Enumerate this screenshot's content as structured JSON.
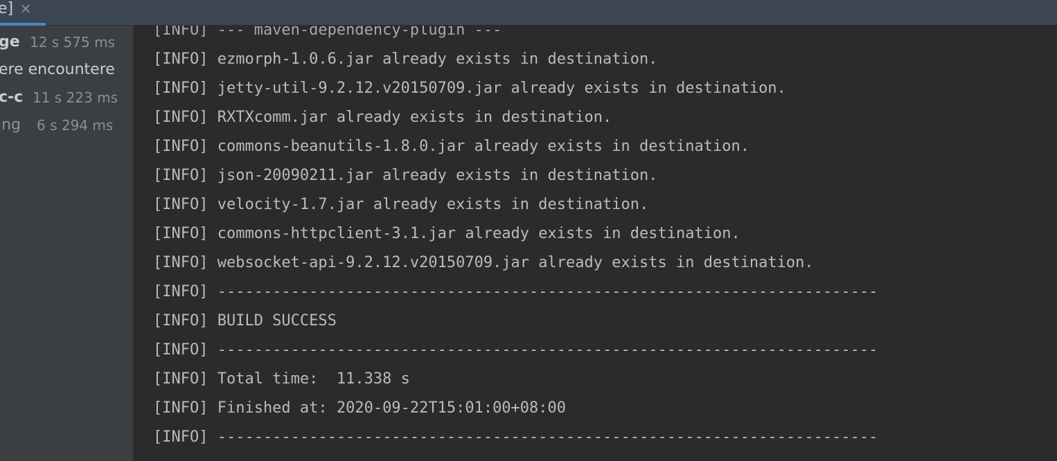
{
  "tab": {
    "label": "e]",
    "close_glyph": "×"
  },
  "sidebar": {
    "items": [
      {
        "name": "ge",
        "time": "12 s 575 ms"
      },
      {
        "name": "ere encountere",
        "time": ""
      },
      {
        "name": "c-c",
        "time": "11 s 223 ms"
      },
      {
        "name": "ing",
        "time": "6 s 294 ms"
      }
    ]
  },
  "console": {
    "partial_line": "[INFO] --- maven-dependency-plugin ---",
    "lines": [
      "[INFO] ezmorph-1.0.6.jar already exists in destination.",
      "[INFO] jetty-util-9.2.12.v20150709.jar already exists in destination.",
      "[INFO] RXTXcomm.jar already exists in destination.",
      "[INFO] commons-beanutils-1.8.0.jar already exists in destination.",
      "[INFO] json-20090211.jar already exists in destination.",
      "[INFO] velocity-1.7.jar already exists in destination.",
      "[INFO] commons-httpclient-3.1.jar already exists in destination.",
      "[INFO] websocket-api-9.2.12.v20150709.jar already exists in destination.",
      "[INFO] ------------------------------------------------------------------------",
      "[INFO] BUILD SUCCESS",
      "[INFO] ------------------------------------------------------------------------",
      "[INFO] Total time:  11.338 s",
      "[INFO] Finished at: 2020-09-22T15:01:00+08:00",
      "[INFO] ------------------------------------------------------------------------"
    ]
  },
  "colors": {
    "tab_accent": "#4a88c7",
    "console_bg": "#2b2b2b",
    "sidebar_bg": "#3c3f41",
    "text": "#bbbbbb"
  }
}
